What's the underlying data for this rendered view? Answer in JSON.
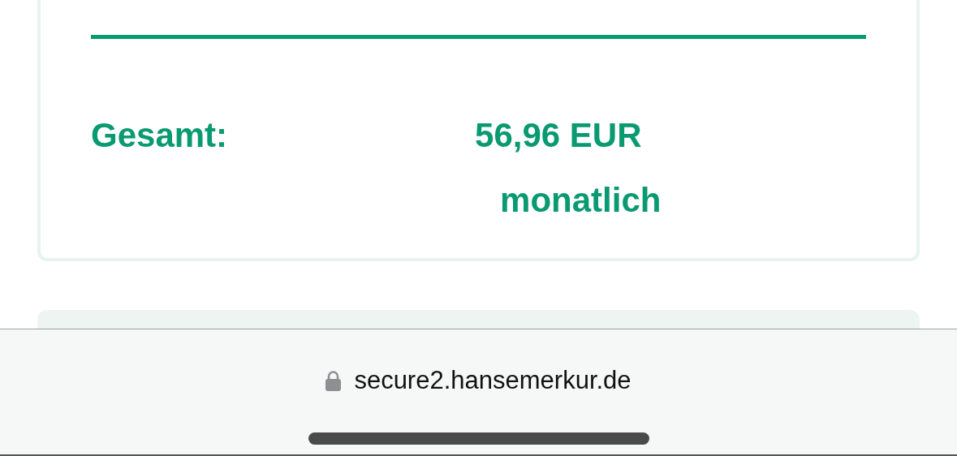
{
  "summary": {
    "total_label": "Gesamt:",
    "total_amount": "56,96 EUR",
    "total_period": "monatlich"
  },
  "browser_bar": {
    "url": "secure2.hansemerkur.de",
    "secure": true
  }
}
